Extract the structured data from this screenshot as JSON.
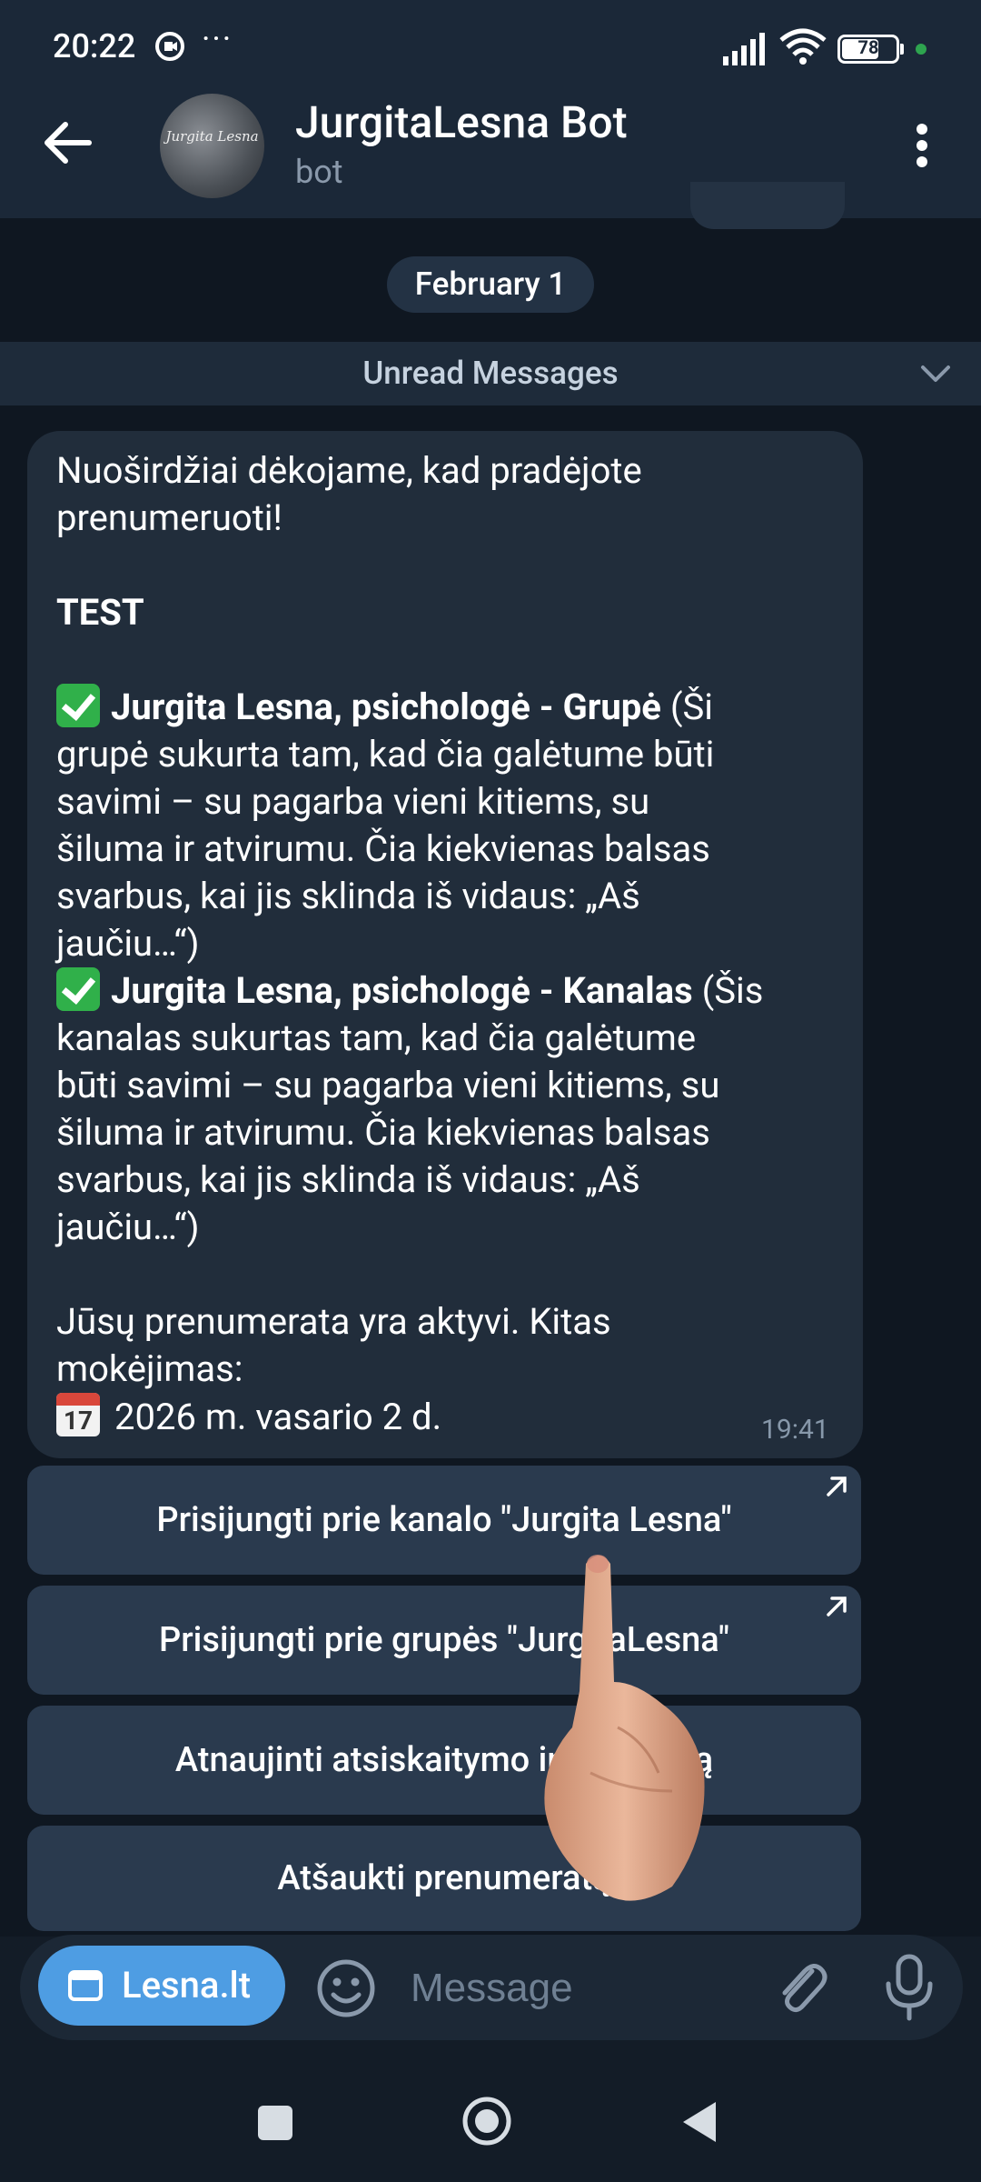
{
  "status_bar": {
    "time": "20:22",
    "more": "···",
    "battery": "78"
  },
  "header": {
    "title": "JurgitaLesna Bot",
    "subtitle": "bot",
    "avatar_text": "Jurgita Lesna"
  },
  "date_chip": "February 1",
  "unread_label": "Unread Messages",
  "message": {
    "line1": "Nuoširdžiai dėkojame, kad pradėjote",
    "line2": "prenumeruoti!",
    "heading": "TEST",
    "item1_bold": "Jurgita Lesna, psichologė - Grupė",
    "item1_rest": " (Ši",
    "item1_lines": [
      "grupė sukurta tam, kad čia galėtume būti",
      "savimi – su pagarba vieni kitiems, su",
      "šiluma ir atvirumu. Čia kiekvienas balsas",
      "svarbus, kai jis sklinda iš vidaus: „Aš",
      "jaučiu…“)"
    ],
    "item2_bold": "Jurgita Lesna, psichologė - Kanalas",
    "item2_rest": " (Šis",
    "item2_lines": [
      "kanalas sukurtas tam, kad čia galėtume",
      "būti savimi – su pagarba vieni kitiems, su",
      "šiluma ir atvirumu. Čia kiekvienas balsas",
      "svarbus, kai jis sklinda iš vidaus: „Aš",
      "jaučiu…“)"
    ],
    "sub_line1": "Jūsų prenumerata yra aktyvi. Kitas",
    "sub_line2": "mokėjimas:",
    "calendar_day": "17",
    "next_payment": "2026 m. vasario 2 d.",
    "time": "19:41"
  },
  "buttons": [
    {
      "label": "Prisijungti prie kanalo \"Jurgita Lesna\""
    },
    {
      "label": "Prisijungti prie grupės \"JurgitaLesna\""
    },
    {
      "label": "Atnaujinti atsiskaitymo informaciją"
    },
    {
      "label": "Atšaukti prenumeratą"
    }
  ],
  "input": {
    "webapp_label": "Lesna.lt",
    "placeholder": "Message"
  }
}
